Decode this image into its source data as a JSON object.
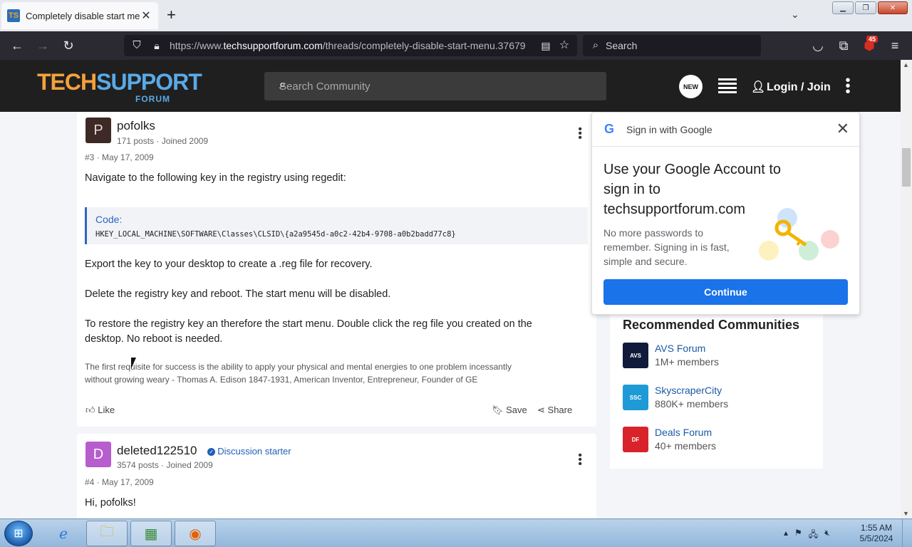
{
  "browser": {
    "tab_title": "Completely disable start menu",
    "tab_favicon_text": "TS",
    "url_prefix": "https://www.",
    "url_domain": "techsupportforum.com",
    "url_path": "/threads/completely-disable-start-menu.37679",
    "search_placeholder": "Search",
    "extension_badge": "45"
  },
  "site": {
    "logo_part1": "TECH",
    "logo_part2": "SUPPORT",
    "logo_sub": "FORUM",
    "search_placeholder": "Search Community",
    "new_badge": "NEW",
    "login_label": "Login / Join"
  },
  "posts": [
    {
      "avatar_letter": "P",
      "username": "pofolks",
      "meta": "171 posts · Joined 2009",
      "post_number": "#3 · May 17, 2009",
      "intro": "Navigate to the following key in the registry using regedit:",
      "code_label": "Code:",
      "code": "HKEY_LOCAL_MACHINE\\SOFTWARE\\Classes\\CLSID\\{a2a9545d-a0c2-42b4-9708-a0b2badd77c8}",
      "p1": "Export the key to your desktop to create a .reg file for recovery.",
      "p2": "Delete the registry key and reboot. The start menu will be disabled.",
      "p3": "To restore the registry key an therefore the start menu. Double click the reg file you created on the desktop. No reboot is needed.",
      "signature": "The first requisite for success is the ability to apply your physical and mental energies to one problem incessantly without growing weary - Thomas A. Edison 1847-1931, American Inventor, Entrepreneur, Founder of GE",
      "like": "Like",
      "save": "Save",
      "share": "Share"
    },
    {
      "avatar_letter": "D",
      "username": "deleted122510",
      "starter_badge": "Discussion starter",
      "meta": "3574 posts · Joined 2009",
      "post_number": "#4 · May 17, 2009",
      "intro": "Hi, pofolks!"
    }
  ],
  "google_popup": {
    "header": "Sign in with Google",
    "title": "Use your Google Account to sign in to techsupportforum.com",
    "description": "No more passwords to remember. Signing in is fast, simple and secure.",
    "button": "Continue"
  },
  "recommended": {
    "title": "Recommended Communities",
    "items": [
      {
        "name": "AVS Forum",
        "members": "1M+ members",
        "logo_text": "AVS",
        "color": "#101a3a"
      },
      {
        "name": "SkyscraperCity",
        "members": "880K+ members",
        "logo_text": "SSC",
        "color": "#1e9ad6"
      },
      {
        "name": "Deals Forum",
        "members": "40+ members",
        "logo_text": "DF",
        "color": "#d8232a"
      }
    ]
  },
  "taskbar": {
    "time": "1:55 AM",
    "date": "5/5/2024"
  },
  "colors": {
    "accent_blue": "#1a73e8",
    "logo_orange": "#f4a13c",
    "logo_blue": "#5aa9e6",
    "starter_blue": "#1f5fb9"
  }
}
